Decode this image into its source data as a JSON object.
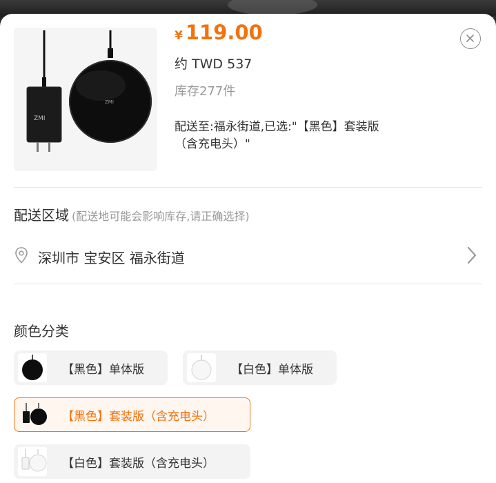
{
  "product": {
    "price_symbol": "¥",
    "price": "119.00",
    "approx_price": "约 TWD 537",
    "stock": "库存277件",
    "delivery_line1": "配送至:福永街道,已选:\"【黑色】套装版",
    "delivery_line2": "（含充电头）\""
  },
  "region": {
    "title": "配送区域",
    "hint": "(配送地可能会影响库存,请正确选择)",
    "address": "深圳市 宝安区 福永街道"
  },
  "color": {
    "title": "颜色分类",
    "options": [
      {
        "label": "【黑色】单体版",
        "selected": false
      },
      {
        "label": "【白色】单体版",
        "selected": false
      },
      {
        "label": "【黑色】套装版（含充电头）",
        "selected": true
      },
      {
        "label": "【白色】套装版（含充电头）",
        "selected": false
      }
    ]
  },
  "colors": {
    "accent": "#f3720d",
    "selected_bg": "#fff6f0",
    "option_bg": "#f3f3f3"
  },
  "icons": {
    "close": "close-icon",
    "location": "location-pin-icon",
    "chevron": "chevron-right-icon"
  }
}
